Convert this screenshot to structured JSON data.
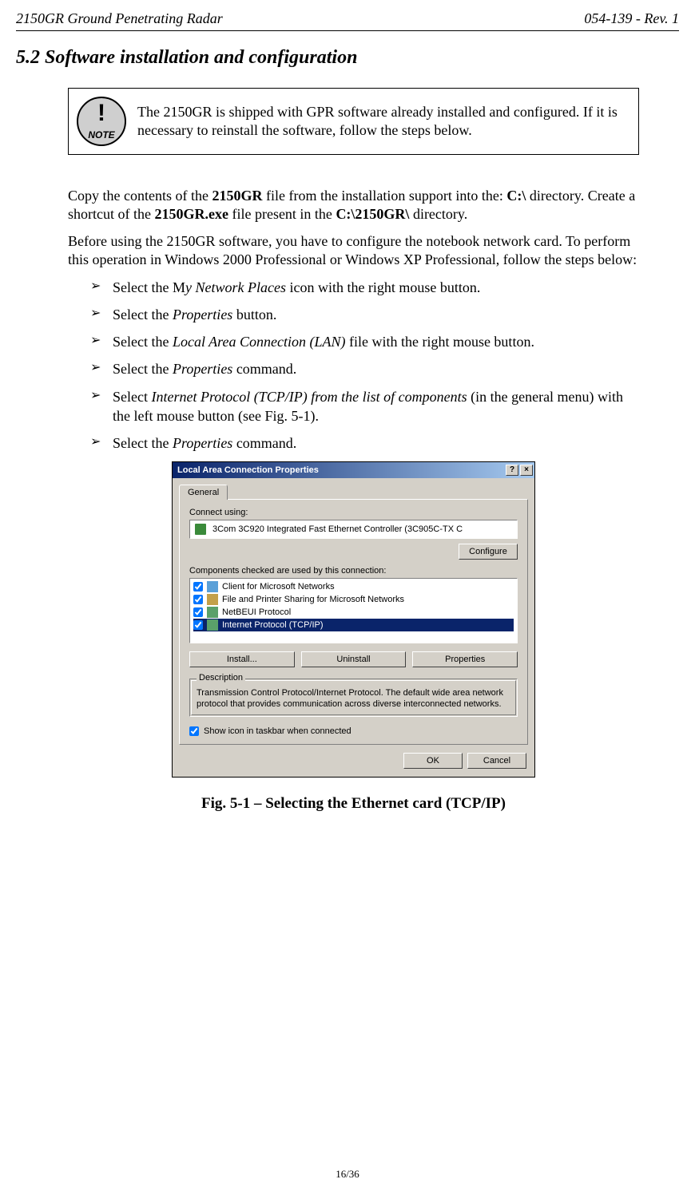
{
  "header": {
    "left": "2150GR Ground Penetrating Radar",
    "right": "054-139 - Rev. 1"
  },
  "section_title": "5.2 Software installation and configuration",
  "note": {
    "excl": "!",
    "word": "NOTE",
    "text": "The 2150GR is shipped with GPR software already installed and configured. If it is necessary to reinstall the software, follow the steps below."
  },
  "para1": {
    "a": "Copy the contents of the ",
    "b1": "2150GR",
    "c": " file from the installation support into the: ",
    "b2": "C:\\",
    "d": " directory. Create a shortcut of the ",
    "b3": "2150GR.exe",
    "e": " file present in the ",
    "b4": "C:\\2150GR\\",
    "f": " directory."
  },
  "para2": "Before using the 2150GR software, you have to configure the notebook network card. To perform this operation in Windows 2000 Professional or Windows XP Professional, follow the steps below:",
  "steps": {
    "s1a": "Select the M",
    "s1b": "y Network Places",
    "s1c": " icon with the right mouse button.",
    "s2a": "Select the ",
    "s2b": "Properties",
    "s2c": " button.",
    "s3a": "Select the ",
    "s3b": "Local Area Connection (LAN)",
    "s3c": " file with the right mouse button.",
    "s4a": "Select the ",
    "s4b": "Properties",
    "s4c": " command.",
    "s5a": "Select ",
    "s5b": "Internet Protocol (TCP/IP) from the list of components",
    "s5c": " (in the general menu) with the left mouse button (see Fig. 5-1).",
    "s6a": "Select the ",
    "s6b": "Properties",
    "s6c": " command."
  },
  "dialog": {
    "title": "Local Area Connection Properties",
    "help": "?",
    "close": "×",
    "tab": "General",
    "connect_using_label": "Connect using:",
    "adapter": "3Com 3C920 Integrated Fast Ethernet Controller (3C905C-TX C",
    "configure_btn": "Configure",
    "components_label": "Components checked are used by this connection:",
    "components": {
      "c0": "Client for Microsoft Networks",
      "c1": "File and Printer Sharing for Microsoft Networks",
      "c2": "NetBEUI Protocol",
      "c3": "Internet Protocol (TCP/IP)"
    },
    "install_btn": "Install...",
    "uninstall_btn": "Uninstall",
    "properties_btn": "Properties",
    "desc_legend": "Description",
    "desc_text": "Transmission Control Protocol/Internet Protocol. The default wide area network protocol that provides communication across diverse interconnected networks.",
    "show_icon": "Show icon in taskbar when connected",
    "ok_btn": "OK",
    "cancel_btn": "Cancel"
  },
  "caption": "Fig. 5-1 – Selecting the Ethernet card (TCP/IP)",
  "page_num": "16/36"
}
